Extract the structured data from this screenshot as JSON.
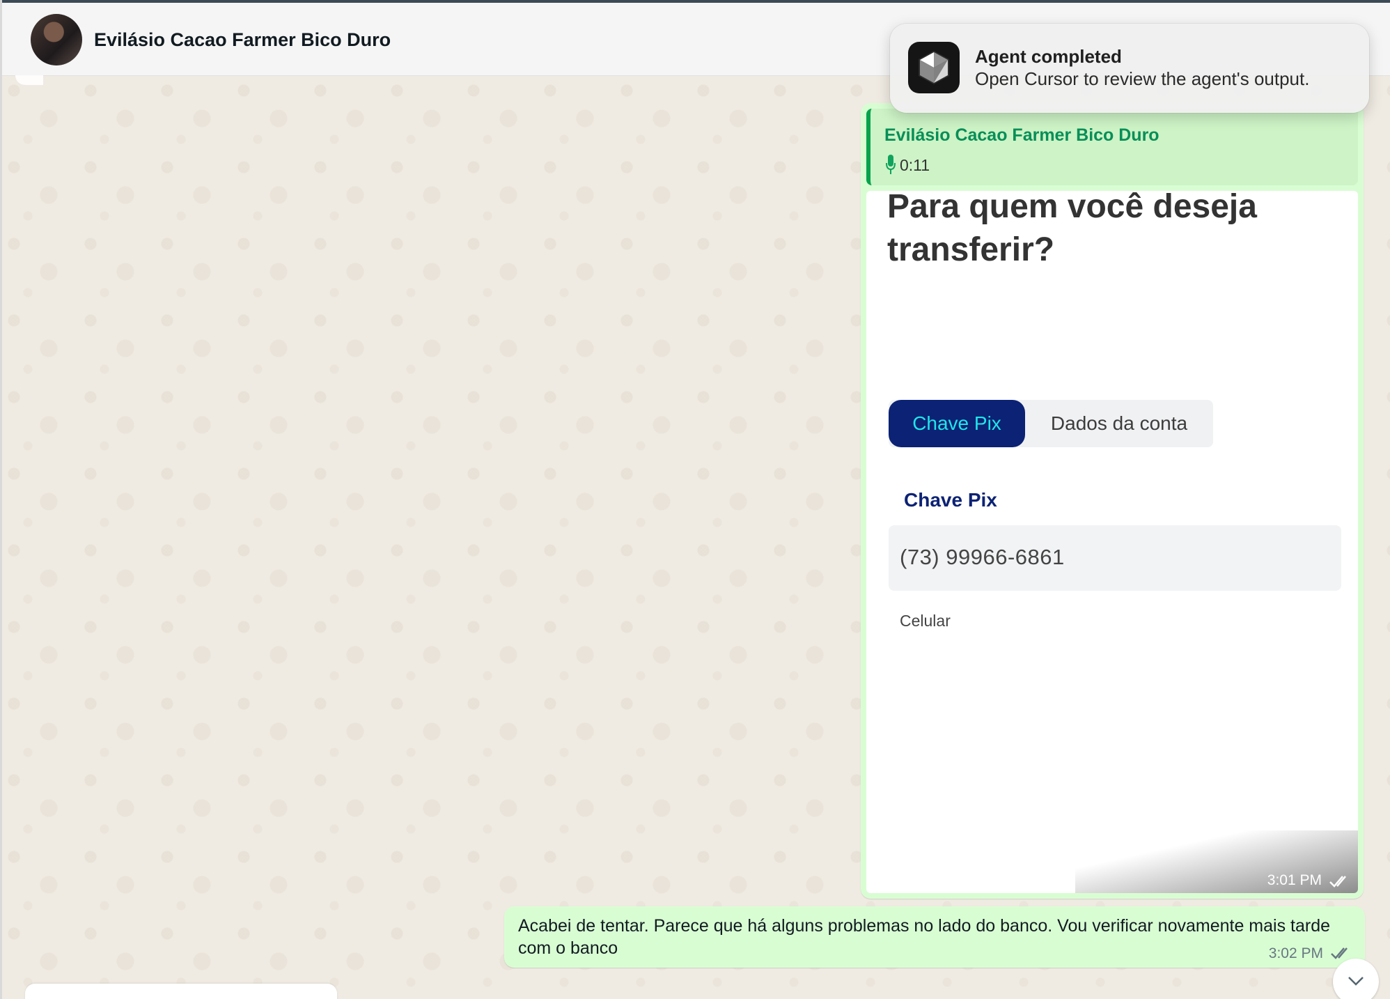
{
  "header": {
    "contact_name": "Evilásio Cacao Farmer Bico Duro"
  },
  "notification": {
    "title": "Agent completed",
    "body": "Open Cursor to review the agent's output.",
    "app_icon": "cursor-app-icon"
  },
  "messages": [
    {
      "quote": {
        "author": "Evilásio Cacao Farmer Bico Duro",
        "voice_duration": "0:11",
        "icon": "microphone-icon"
      },
      "image": {
        "title": "Para quem você deseja transferir?",
        "tabs": [
          "Chave Pix",
          "Dados da conta"
        ],
        "active_tab": "Chave Pix",
        "field_label": "Chave Pix",
        "field_value": "(73) 99966-6861",
        "field_hint": "Celular"
      },
      "time": "3:01 PM",
      "status_icon": "double-check-icon"
    },
    {
      "text": "Acabei de tentar. Parece que há alguns problemas no lado do banco. Vou verificar novamente mais tarde com o banco",
      "time": "3:02 PM",
      "status_icon": "double-check-icon"
    }
  ],
  "colors": {
    "chat_background": "#efeae2",
    "outgoing_bubble": "#d9fdd3",
    "quote_accent": "#06a34c",
    "bank_primary": "#0c2274",
    "bank_active_text": "#20e5ea"
  }
}
